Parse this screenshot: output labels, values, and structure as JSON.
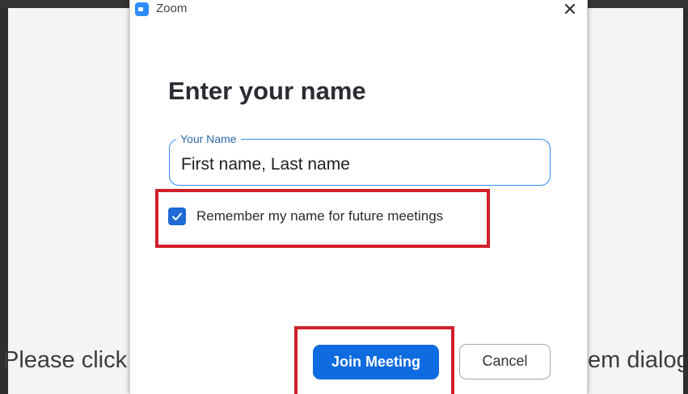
{
  "background": {
    "left_text": "Please click",
    "right_text": "em dialog"
  },
  "dialog": {
    "app_title": "Zoom",
    "close_glyph": "✕",
    "heading": "Enter your name",
    "name_field": {
      "label": "Your Name",
      "value": "First name, Last name",
      "placeholder": "Your Name"
    },
    "remember": {
      "checked": true,
      "label": "Remember my name for future meetings"
    },
    "join_label": "Join Meeting",
    "cancel_label": "Cancel"
  },
  "colors": {
    "accent": "#0e6be0",
    "highlight": "#d11f2c",
    "field_border": "#2d8cff"
  },
  "icons": [
    "zoom-app-icon",
    "close-icon",
    "checkmark-icon"
  ]
}
